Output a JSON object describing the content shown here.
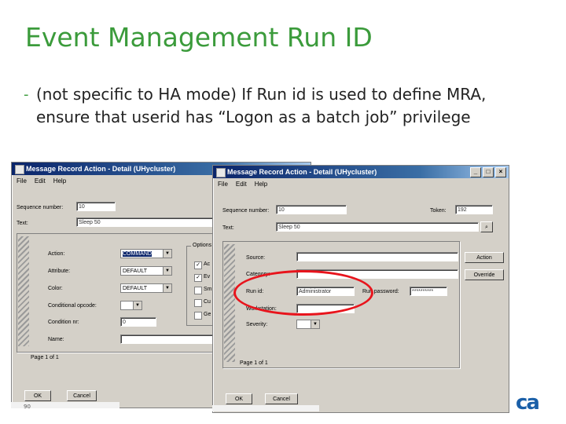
{
  "slide": {
    "title": "Event Management Run ID",
    "bullet": "(not specific to HA mode) If Run id is used to define MRA, ensure that userid has “Logon as a batch job” privilege",
    "page_number": "90"
  },
  "win1": {
    "title": "Message Record Action - Detail (UHycluster)",
    "menu": [
      "File",
      "Edit",
      "Help"
    ],
    "sequence_label": "Sequence number:",
    "sequence_value": "10",
    "text_label": "Text:",
    "text_value": "Sleep 50",
    "action_label": "Action:",
    "action_value": "COMMAND",
    "attribute_label": "Attribute:",
    "attribute_value": "DEFAULT",
    "color_label": "Color:",
    "color_value": "DEFAULT",
    "cond_label": "Conditional opcode:",
    "cond_value": "",
    "condnum_label": "Condition nr:",
    "condnum_value": "0",
    "name_label": "Name:",
    "options_label": "Options",
    "checks": [
      {
        "label": "Ac",
        "checked": true
      },
      {
        "label": "Ev",
        "checked": true
      },
      {
        "label": "Sm",
        "checked": false
      },
      {
        "label": "Cu",
        "checked": false
      },
      {
        "label": "Ge",
        "checked": false
      }
    ],
    "status": "Page 1 of 1",
    "ok": "OK",
    "cancel": "Cancel"
  },
  "win2": {
    "title": "Message Record Action - Detail (UHycluster)",
    "menu": [
      "File",
      "Edit",
      "Help"
    ],
    "sequence_label": "Sequence number:",
    "sequence_value": "10",
    "token_label": "Token:",
    "token_value": "192",
    "text_label": "Text:",
    "text_value": "Sleep 50",
    "source_label": "Source:",
    "category_label": "Category:",
    "runid_label": "Run id:",
    "runid_value": "Administrator",
    "runpwd_label": "Run password:",
    "runpwd_value": "**********",
    "workstation_label": "Workstation:",
    "severity_label": "Severity:",
    "action_btn": "Action",
    "override_btn": "Override",
    "status": "Page 1 of 1",
    "ok": "OK",
    "cancel": "Cancel"
  },
  "logo": {
    "text": "ca",
    "color": "#1a5fa8"
  },
  "accent_color": "#3b9b3b",
  "highlight_color": "#e8141c"
}
